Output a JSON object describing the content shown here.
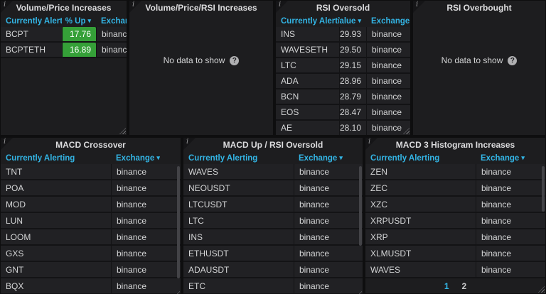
{
  "icons": {
    "info": "i",
    "sort_caret": "▾",
    "help": "?"
  },
  "colors": {
    "page_bg": "#0e0e0f",
    "panel_bg": "#1d1d1f",
    "accent_blue": "#33b5e5",
    "positive_green": "#35a038",
    "row_bg": "#212124"
  },
  "panels": {
    "volume_price": {
      "title": "Volume/Price Increases",
      "columns": [
        {
          "key": "symbol",
          "label": "Currently Alerting"
        },
        {
          "key": "percent-up",
          "label": "% Up",
          "sorted": true,
          "align": "right",
          "type": "green"
        },
        {
          "key": "exchange",
          "label": "Exchange"
        }
      ],
      "rows": [
        [
          "BCPT",
          "17.76",
          "binance"
        ],
        [
          "BCPTETH",
          "16.89",
          "binance"
        ]
      ]
    },
    "volume_price_rsi": {
      "title": "Volume/Price/RSI Increases",
      "no_data": "No data to show"
    },
    "rsi_oversold": {
      "title": "RSI Oversold",
      "columns": [
        {
          "key": "symbol",
          "label": "Currently Alerting"
        },
        {
          "key": "value",
          "label": "Value",
          "sorted": true,
          "align": "right"
        },
        {
          "key": "exchange",
          "label": "Exchange"
        }
      ],
      "rows": [
        [
          "INS",
          "29.93",
          "binance"
        ],
        [
          "WAVESETH",
          "29.50",
          "binance"
        ],
        [
          "LTC",
          "29.15",
          "binance"
        ],
        [
          "ADA",
          "28.96",
          "binance"
        ],
        [
          "BCN",
          "28.79",
          "binance"
        ],
        [
          "EOS",
          "28.47",
          "binance"
        ],
        [
          "AE",
          "28.10",
          "binance"
        ]
      ]
    },
    "rsi_overbought": {
      "title": "RSI Overbought",
      "no_data": "No data to show"
    },
    "macd_crossover": {
      "title": "MACD Crossover",
      "columns": [
        {
          "key": "symbol",
          "label": "Currently Alerting"
        },
        {
          "key": "exchange",
          "label": "Exchange",
          "sorted": true
        }
      ],
      "rows": [
        [
          "TNT",
          "binance"
        ],
        [
          "POA",
          "binance"
        ],
        [
          "MOD",
          "binance"
        ],
        [
          "LUN",
          "binance"
        ],
        [
          "LOOM",
          "binance"
        ],
        [
          "GXS",
          "binance"
        ],
        [
          "GNT",
          "binance"
        ],
        [
          "BQX",
          "binance"
        ]
      ]
    },
    "macd_up_rsi_oversold": {
      "title": "MACD Up / RSI Oversold",
      "columns": [
        {
          "key": "symbol",
          "label": "Currently Alerting"
        },
        {
          "key": "exchange",
          "label": "Exchange",
          "sorted": true
        }
      ],
      "rows": [
        [
          "WAVES",
          "binance"
        ],
        [
          "NEOUSDT",
          "binance"
        ],
        [
          "LTCUSDT",
          "binance"
        ],
        [
          "LTC",
          "binance"
        ],
        [
          "INS",
          "binance"
        ],
        [
          "ETHUSDT",
          "binance"
        ],
        [
          "ADAUSDT",
          "binance"
        ],
        [
          "ETC",
          "binance"
        ]
      ]
    },
    "macd_3_histogram": {
      "title": "MACD 3 Histogram Increases",
      "columns": [
        {
          "key": "symbol",
          "label": "Currently Alerting"
        },
        {
          "key": "exchange",
          "label": "Exchange",
          "sorted": true
        }
      ],
      "rows": [
        [
          "ZEN",
          "binance"
        ],
        [
          "ZEC",
          "binance"
        ],
        [
          "XZC",
          "binance"
        ],
        [
          "XRPUSDT",
          "binance"
        ],
        [
          "XRP",
          "binance"
        ],
        [
          "XLMUSDT",
          "binance"
        ],
        [
          "WAVES",
          "binance"
        ]
      ],
      "pagination": {
        "pages": [
          "1",
          "2"
        ],
        "current": "1"
      }
    }
  }
}
